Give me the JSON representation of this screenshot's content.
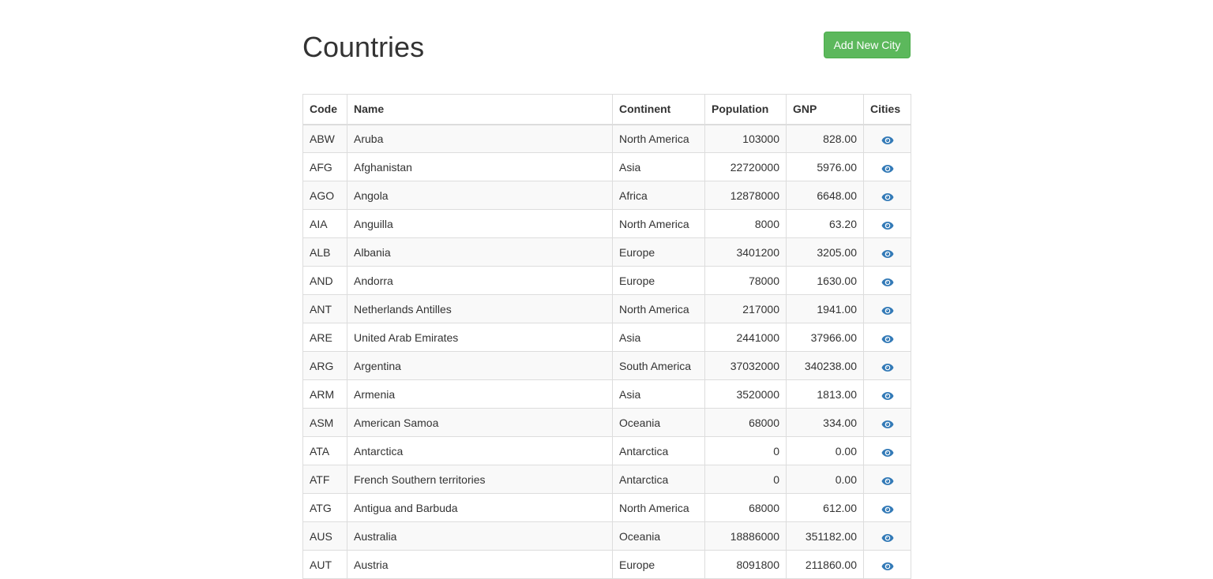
{
  "header": {
    "title": "Countries",
    "add_button_label": "Add New City"
  },
  "table": {
    "columns": [
      "Code",
      "Name",
      "Continent",
      "Population",
      "GNP",
      "Cities"
    ],
    "rows": [
      {
        "code": "ABW",
        "name": "Aruba",
        "continent": "North America",
        "population": "103000",
        "gnp": "828.00"
      },
      {
        "code": "AFG",
        "name": "Afghanistan",
        "continent": "Asia",
        "population": "22720000",
        "gnp": "5976.00"
      },
      {
        "code": "AGO",
        "name": "Angola",
        "continent": "Africa",
        "population": "12878000",
        "gnp": "6648.00"
      },
      {
        "code": "AIA",
        "name": "Anguilla",
        "continent": "North America",
        "population": "8000",
        "gnp": "63.20"
      },
      {
        "code": "ALB",
        "name": "Albania",
        "continent": "Europe",
        "population": "3401200",
        "gnp": "3205.00"
      },
      {
        "code": "AND",
        "name": "Andorra",
        "continent": "Europe",
        "population": "78000",
        "gnp": "1630.00"
      },
      {
        "code": "ANT",
        "name": "Netherlands Antilles",
        "continent": "North America",
        "population": "217000",
        "gnp": "1941.00"
      },
      {
        "code": "ARE",
        "name": "United Arab Emirates",
        "continent": "Asia",
        "population": "2441000",
        "gnp": "37966.00"
      },
      {
        "code": "ARG",
        "name": "Argentina",
        "continent": "South America",
        "population": "37032000",
        "gnp": "340238.00"
      },
      {
        "code": "ARM",
        "name": "Armenia",
        "continent": "Asia",
        "population": "3520000",
        "gnp": "1813.00"
      },
      {
        "code": "ASM",
        "name": "American Samoa",
        "continent": "Oceania",
        "population": "68000",
        "gnp": "334.00"
      },
      {
        "code": "ATA",
        "name": "Antarctica",
        "continent": "Antarctica",
        "population": "0",
        "gnp": "0.00"
      },
      {
        "code": "ATF",
        "name": "French Southern territories",
        "continent": "Antarctica",
        "population": "0",
        "gnp": "0.00"
      },
      {
        "code": "ATG",
        "name": "Antigua and Barbuda",
        "continent": "North America",
        "population": "68000",
        "gnp": "612.00"
      },
      {
        "code": "AUS",
        "name": "Australia",
        "continent": "Oceania",
        "population": "18886000",
        "gnp": "351182.00"
      },
      {
        "code": "AUT",
        "name": "Austria",
        "continent": "Europe",
        "population": "8091800",
        "gnp": "211860.00"
      }
    ],
    "cities_icon": "eye-icon"
  },
  "colors": {
    "button_green": "#5cb85c",
    "icon_blue": "#337ab7",
    "stripe": "#f9f9f9",
    "border": "#dddddd"
  }
}
